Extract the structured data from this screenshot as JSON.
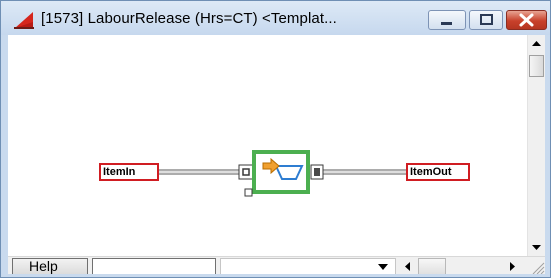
{
  "window": {
    "title": "[1573]  LabourRelease (Hrs=CT)  <Templat...",
    "minimize_label": "",
    "maximize_label": "",
    "close_label": ""
  },
  "diagram": {
    "input_connector": "ItemIn",
    "output_connector": "ItemOut",
    "block_icon": "labour-release-block-icon"
  },
  "bottom_bar": {
    "help_label": "Help",
    "status_value": "",
    "dropdown_value": ""
  },
  "colors": {
    "connector_border": "#d01d22",
    "block_border": "#4caf50",
    "block_arrow": "#f0a030",
    "title_bg": "#c9daee",
    "close_button": "#c8412b"
  }
}
